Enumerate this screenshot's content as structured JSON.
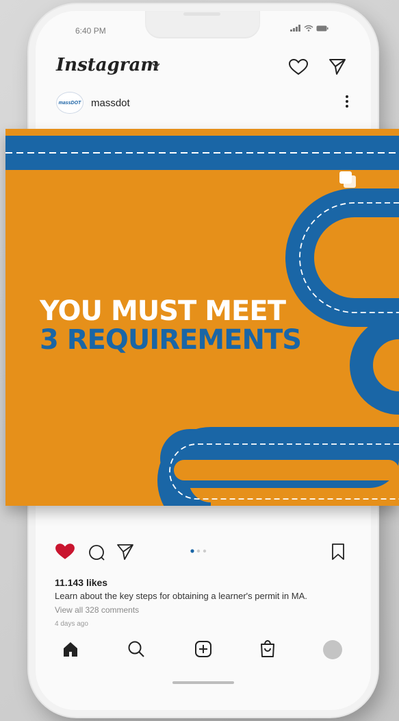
{
  "status": {
    "time": "6:40 PM"
  },
  "header": {
    "logo": "Instagram",
    "icons": [
      "chevron-down-icon",
      "heart-icon",
      "send-icon"
    ]
  },
  "account": {
    "avatar_text": "massDOT",
    "username": "massdot"
  },
  "post": {
    "headline_line1": "YOU MUST MEET",
    "headline_line2": "3 REQUIREMENTS",
    "colors": {
      "background": "#e6901a",
      "road": "#1a66a6",
      "headline1": "#ffffff",
      "headline2": "#1a66a6"
    },
    "carousel": {
      "current": 1,
      "total": 3
    }
  },
  "actions": {
    "liked": true,
    "icons": [
      "heart-filled-icon",
      "comment-icon",
      "send-icon",
      "bookmark-icon"
    ]
  },
  "engagement": {
    "likes": "11.143 likes",
    "caption": "Learn about the key steps for obtaining a learner's permit in MA.",
    "comments_link": "View all 328 comments",
    "time_ago": "4 days ago"
  },
  "nav": {
    "items": [
      "home-icon",
      "search-icon",
      "add-post-icon",
      "shop-icon",
      "profile-avatar"
    ]
  }
}
